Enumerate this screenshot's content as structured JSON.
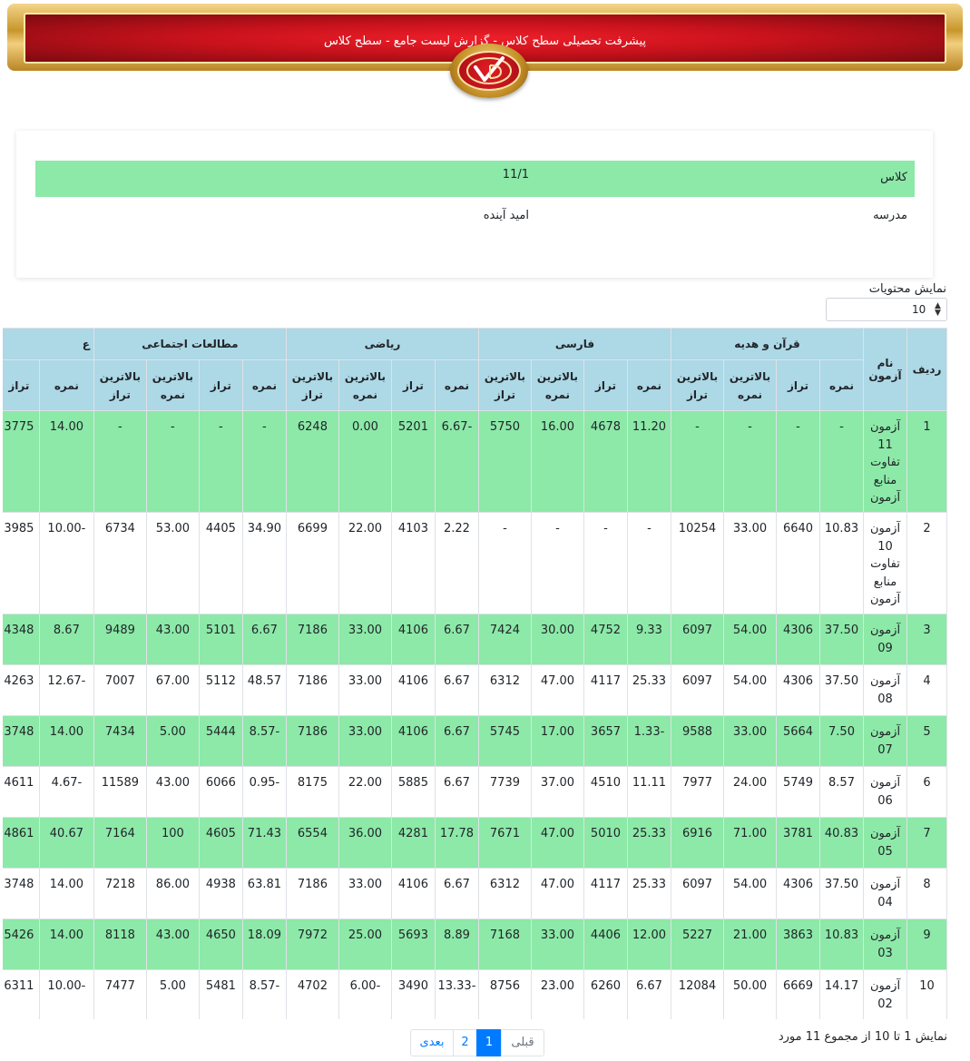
{
  "banner": {
    "title": "پیشرفت تحصیلی سطح کلاس - گزارش لیست جامع - سطح کلاس"
  },
  "info": {
    "rows": [
      {
        "label": "کلاس",
        "value": "11/1"
      },
      {
        "label": "مدرسه",
        "value": "امید آینده"
      }
    ]
  },
  "entries": {
    "label": "نمایش محتویات",
    "selected": "10"
  },
  "table": {
    "col_row": "ردیف",
    "col_name": "نام آزمون",
    "groups": [
      "قرآن و هدیه",
      "فارسی",
      "ریاضی",
      "مطالعات اجتماعی",
      "ع"
    ],
    "subheaders": [
      "نمره",
      "تراز",
      "بالاترین نمره",
      "بالاترین تراز"
    ],
    "rows": [
      {
        "id": "1",
        "name": "آزمون 11 تفاوت منابع آزمون",
        "cells": [
          "-",
          "-",
          "-",
          "-",
          "11.20",
          "4678",
          "16.00",
          "5750",
          "-6.67",
          "5201",
          "0.00",
          "6248",
          "-",
          "-",
          "-",
          "-",
          "14.00",
          "3775"
        ]
      },
      {
        "id": "2",
        "name": "آزمون 10 تفاوت منابع آزمون",
        "cells": [
          "10.83",
          "6640",
          "33.00",
          "10254",
          "-",
          "-",
          "-",
          "-",
          "2.22",
          "4103",
          "22.00",
          "6699",
          "34.90",
          "4405",
          "53.00",
          "6734",
          "-10.00",
          "3985"
        ]
      },
      {
        "id": "3",
        "name": "آزمون 09",
        "cells": [
          "37.50",
          "4306",
          "54.00",
          "6097",
          "9.33",
          "4752",
          "30.00",
          "7424",
          "6.67",
          "4106",
          "33.00",
          "7186",
          "6.67",
          "5101",
          "43.00",
          "9489",
          "8.67",
          "4348"
        ]
      },
      {
        "id": "4",
        "name": "آزمون 08",
        "cells": [
          "37.50",
          "4306",
          "54.00",
          "6097",
          "25.33",
          "4117",
          "47.00",
          "6312",
          "6.67",
          "4106",
          "33.00",
          "7186",
          "48.57",
          "5112",
          "67.00",
          "7007",
          "-12.67",
          "4263"
        ]
      },
      {
        "id": "5",
        "name": "آزمون 07",
        "cells": [
          "7.50",
          "5664",
          "33.00",
          "9588",
          "-1.33",
          "3657",
          "17.00",
          "5745",
          "6.67",
          "4106",
          "33.00",
          "7186",
          "-8.57",
          "5444",
          "5.00",
          "7434",
          "14.00",
          "3748"
        ]
      },
      {
        "id": "6",
        "name": "آزمون 06",
        "cells": [
          "8.57",
          "5749",
          "24.00",
          "7977",
          "11.11",
          "4510",
          "37.00",
          "7739",
          "6.67",
          "5885",
          "22.00",
          "8175",
          "-0.95",
          "6066",
          "43.00",
          "11589",
          "-4.67",
          "4611"
        ]
      },
      {
        "id": "7",
        "name": "آزمون 05",
        "cells": [
          "40.83",
          "3781",
          "71.00",
          "6916",
          "25.33",
          "5010",
          "47.00",
          "7671",
          "17.78",
          "4281",
          "36.00",
          "6554",
          "71.43",
          "4605",
          "100",
          "7164",
          "40.67",
          "4861"
        ]
      },
      {
        "id": "8",
        "name": "آزمون 04",
        "cells": [
          "37.50",
          "4306",
          "54.00",
          "6097",
          "25.33",
          "4117",
          "47.00",
          "6312",
          "6.67",
          "4106",
          "33.00",
          "7186",
          "63.81",
          "4938",
          "86.00",
          "7218",
          "14.00",
          "3748"
        ]
      },
      {
        "id": "9",
        "name": "آزمون 03",
        "cells": [
          "10.83",
          "3863",
          "21.00",
          "5227",
          "12.00",
          "4406",
          "33.00",
          "7168",
          "8.89",
          "5693",
          "25.00",
          "7972",
          "18.09",
          "4650",
          "43.00",
          "8118",
          "14.00",
          "5426"
        ]
      },
      {
        "id": "10",
        "name": "آزمون 02",
        "cells": [
          "14.17",
          "6669",
          "50.00",
          "12084",
          "6.67",
          "6260",
          "23.00",
          "8756",
          "-13.33",
          "3490",
          "-6.00",
          "4702",
          "-8.57",
          "5481",
          "5.00",
          "7477",
          "-10.00",
          "6311"
        ]
      }
    ]
  },
  "footer": {
    "info": "نمایش 1 تا 10 از مجموع 11 مورد",
    "prev": "قبلی",
    "next": "بعدی",
    "pages": [
      "1",
      "2"
    ]
  },
  "colors": {
    "row_highlight": "#8ce9a8",
    "header_bg": "#add8e6",
    "active_page": "#007bff"
  }
}
